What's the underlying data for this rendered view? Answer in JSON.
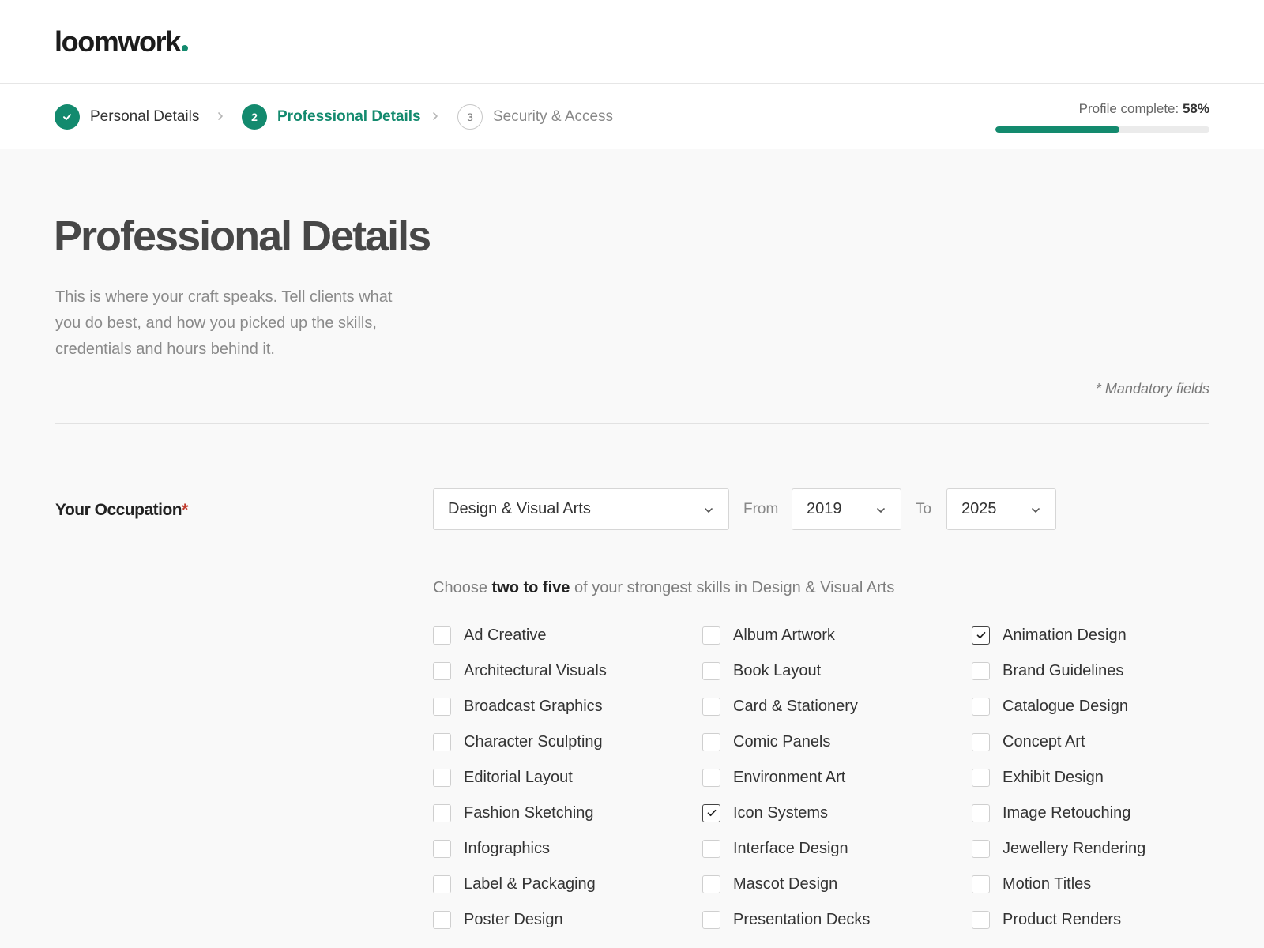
{
  "brand": {
    "name": "loomwork",
    "accent": "#138a6e"
  },
  "steps": [
    {
      "label": "Personal Details",
      "state": "done",
      "number": ""
    },
    {
      "label": "Professional Details",
      "state": "active",
      "number": "2"
    },
    {
      "label": "Security & Access",
      "state": "todo",
      "number": "3"
    }
  ],
  "progress": {
    "label": "Profile complete:",
    "value_text": "58%",
    "value": 0.58
  },
  "page": {
    "title": "Professional Details",
    "intro": "This is where your craft speaks. Tell clients what you do best, and how you picked up the skills, credentials and hours behind it.",
    "mandatory_note": "* Mandatory fields"
  },
  "occupation": {
    "label": "Your Occupation",
    "required_mark": "*",
    "value": "Design & Visual Arts",
    "from_label": "From",
    "from_value": "2019",
    "to_label": "To",
    "to_value": "2025"
  },
  "skills_hint": {
    "prefix": "Choose",
    "emphasis": "two to five",
    "suffix": "of your strongest skills in Design & Visual Arts"
  },
  "skills": [
    {
      "label": "Ad Creative",
      "checked": false
    },
    {
      "label": "Album Artwork",
      "checked": false
    },
    {
      "label": "Animation Design",
      "checked": true
    },
    {
      "label": "Architectural Visuals",
      "checked": false
    },
    {
      "label": "Book Layout",
      "checked": false
    },
    {
      "label": "Brand Guidelines",
      "checked": false
    },
    {
      "label": "Broadcast Graphics",
      "checked": false
    },
    {
      "label": "Card & Stationery",
      "checked": false
    },
    {
      "label": "Catalogue Design",
      "checked": false
    },
    {
      "label": "Character Sculpting",
      "checked": false
    },
    {
      "label": "Comic Panels",
      "checked": false
    },
    {
      "label": "Concept Art",
      "checked": false
    },
    {
      "label": "Editorial Layout",
      "checked": false
    },
    {
      "label": "Environment Art",
      "checked": false
    },
    {
      "label": "Exhibit Design",
      "checked": false
    },
    {
      "label": "Fashion Sketching",
      "checked": false
    },
    {
      "label": "Icon Systems",
      "checked": true
    },
    {
      "label": "Image Retouching",
      "checked": false
    },
    {
      "label": "Infographics",
      "checked": false
    },
    {
      "label": "Interface Design",
      "checked": false
    },
    {
      "label": "Jewellery Rendering",
      "checked": false
    },
    {
      "label": "Label & Packaging",
      "checked": false
    },
    {
      "label": "Mascot Design",
      "checked": false
    },
    {
      "label": "Motion Titles",
      "checked": false
    },
    {
      "label": "Poster Design",
      "checked": false
    },
    {
      "label": "Presentation Decks",
      "checked": false
    },
    {
      "label": "Product Renders",
      "checked": false
    }
  ]
}
